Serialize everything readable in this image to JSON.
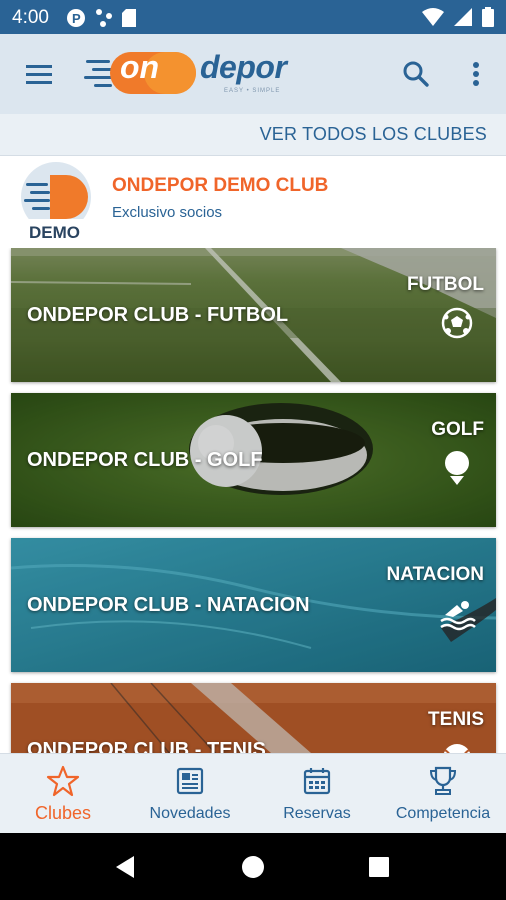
{
  "status_bar": {
    "time": "4:00",
    "left_icons": [
      "p-badge-icon",
      "usb-icon",
      "sd-card-icon"
    ],
    "right_icons": [
      "wifi-icon",
      "signal-icon",
      "battery-icon"
    ]
  },
  "app_bar": {
    "logo_text": "depor",
    "logo_prefix": "on",
    "logo_tagline": "EASY • SIMPLE",
    "icons": [
      "menu-icon",
      "search-icon",
      "more-vert-icon"
    ]
  },
  "see_all": {
    "label": "VER TODOS LOS CLUBES"
  },
  "club": {
    "name": "ONDEPOR DEMO CLUB",
    "subtitle": "Exclusivo socios",
    "logo_text": "DEMO"
  },
  "cards": [
    {
      "title": "ONDEPOR CLUB - FUTBOL",
      "sport": "FUTBOL",
      "icon": "soccer-ball-icon"
    },
    {
      "title": "ONDEPOR CLUB - GOLF",
      "sport": "GOLF",
      "icon": "golf-ball-icon"
    },
    {
      "title": "ONDEPOR CLUB - NATACION",
      "sport": "NATACION",
      "icon": "swimmer-icon"
    },
    {
      "title": "ONDEPOR CLUB - TENIS",
      "sport": "TENIS",
      "icon": "tennis-ball-icon"
    }
  ],
  "bottom_nav": [
    {
      "label": "Clubes",
      "icon": "star-icon",
      "active": true
    },
    {
      "label": "Novedades",
      "icon": "newspaper-icon",
      "active": false
    },
    {
      "label": "Reservas",
      "icon": "calendar-icon",
      "active": false
    },
    {
      "label": "Competencia",
      "icon": "trophy-icon",
      "active": false
    }
  ],
  "colors": {
    "primary": "#2a6395",
    "accent": "#f0652a",
    "app_bar_bg": "#dce6ef",
    "bottom_nav_bg": "#eaf0f5"
  }
}
